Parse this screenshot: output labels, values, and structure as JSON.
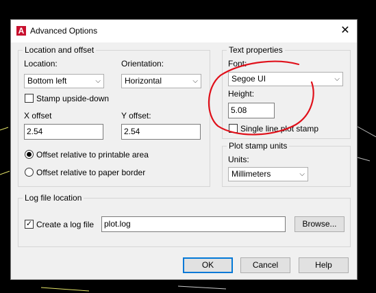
{
  "window": {
    "title": "Advanced Options",
    "icon_letter": "A",
    "close_glyph": "✕"
  },
  "location_offset": {
    "group_label": "Location and offset",
    "location_label": "Location:",
    "location_value": "Bottom left",
    "orientation_label": "Orientation:",
    "orientation_value": "Horizontal",
    "stamp_upside_down_label": "Stamp upside-down",
    "stamp_upside_down_checked": false,
    "x_offset_label": "X offset",
    "x_offset_value": "2.54",
    "y_offset_label": "Y offset:",
    "y_offset_value": "2.54",
    "radio_printable_label": "Offset relative to printable area",
    "radio_paper_label": "Offset relative to paper border",
    "selected_offset": "printable"
  },
  "text_properties": {
    "group_label": "Text properties",
    "font_label": "Font:",
    "font_value": "Segoe UI",
    "height_label": "Height:",
    "height_value": "5.08",
    "single_line_label": "Single line plot stamp",
    "single_line_checked": false
  },
  "plot_stamp_units": {
    "group_label": "Plot stamp units",
    "units_label": "Units:",
    "units_value": "Millimeters"
  },
  "log_file": {
    "group_label": "Log file location",
    "create_log_label": "Create a log file",
    "create_log_checked": true,
    "check_glyph": "✓",
    "path_value": "plot.log",
    "browse_label": "Browse..."
  },
  "buttons": {
    "ok": "OK",
    "cancel": "Cancel",
    "help": "Help"
  },
  "icons": {
    "chevron": "⌵"
  },
  "colors": {
    "annotation_red": "#e0101a",
    "app_icon_red": "#c8102e",
    "default_button_border": "#0078d7"
  }
}
